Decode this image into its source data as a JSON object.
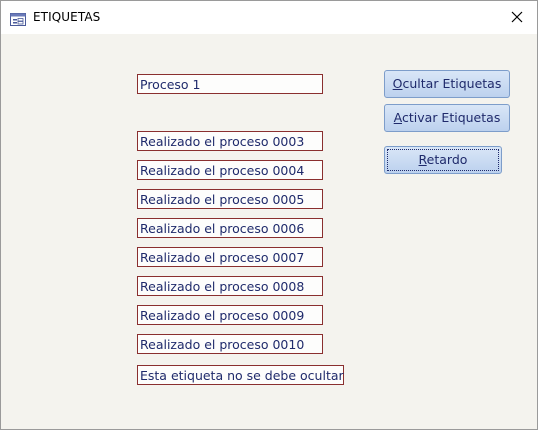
{
  "window": {
    "title": "ETIQUETAS",
    "title_icon": "form-icon",
    "close_icon": "close-icon"
  },
  "labels": {
    "process_title": "Proceso 1",
    "steps": [
      "Realizado el proceso 0003",
      "Realizado el proceso 0004",
      "Realizado el proceso 0005",
      "Realizado el proceso 0006",
      "Realizado el proceso 0007",
      "Realizado el proceso 0008",
      "Realizado el proceso 0009",
      "Realizado el proceso 0010"
    ],
    "permanent": "Esta etiqueta no se debe ocultar"
  },
  "buttons": {
    "hide_accel": "O",
    "hide_rest": "cultar Etiquetas",
    "activate_accel": "A",
    "activate_rest": "ctivar Etiquetas",
    "delay_accel": "R",
    "delay_rest": "etardo"
  },
  "colors": {
    "label_border": "#8a2f2f",
    "label_text": "#1f2a6b",
    "button_border": "#7d9dca",
    "background": "#f4f3ee"
  }
}
